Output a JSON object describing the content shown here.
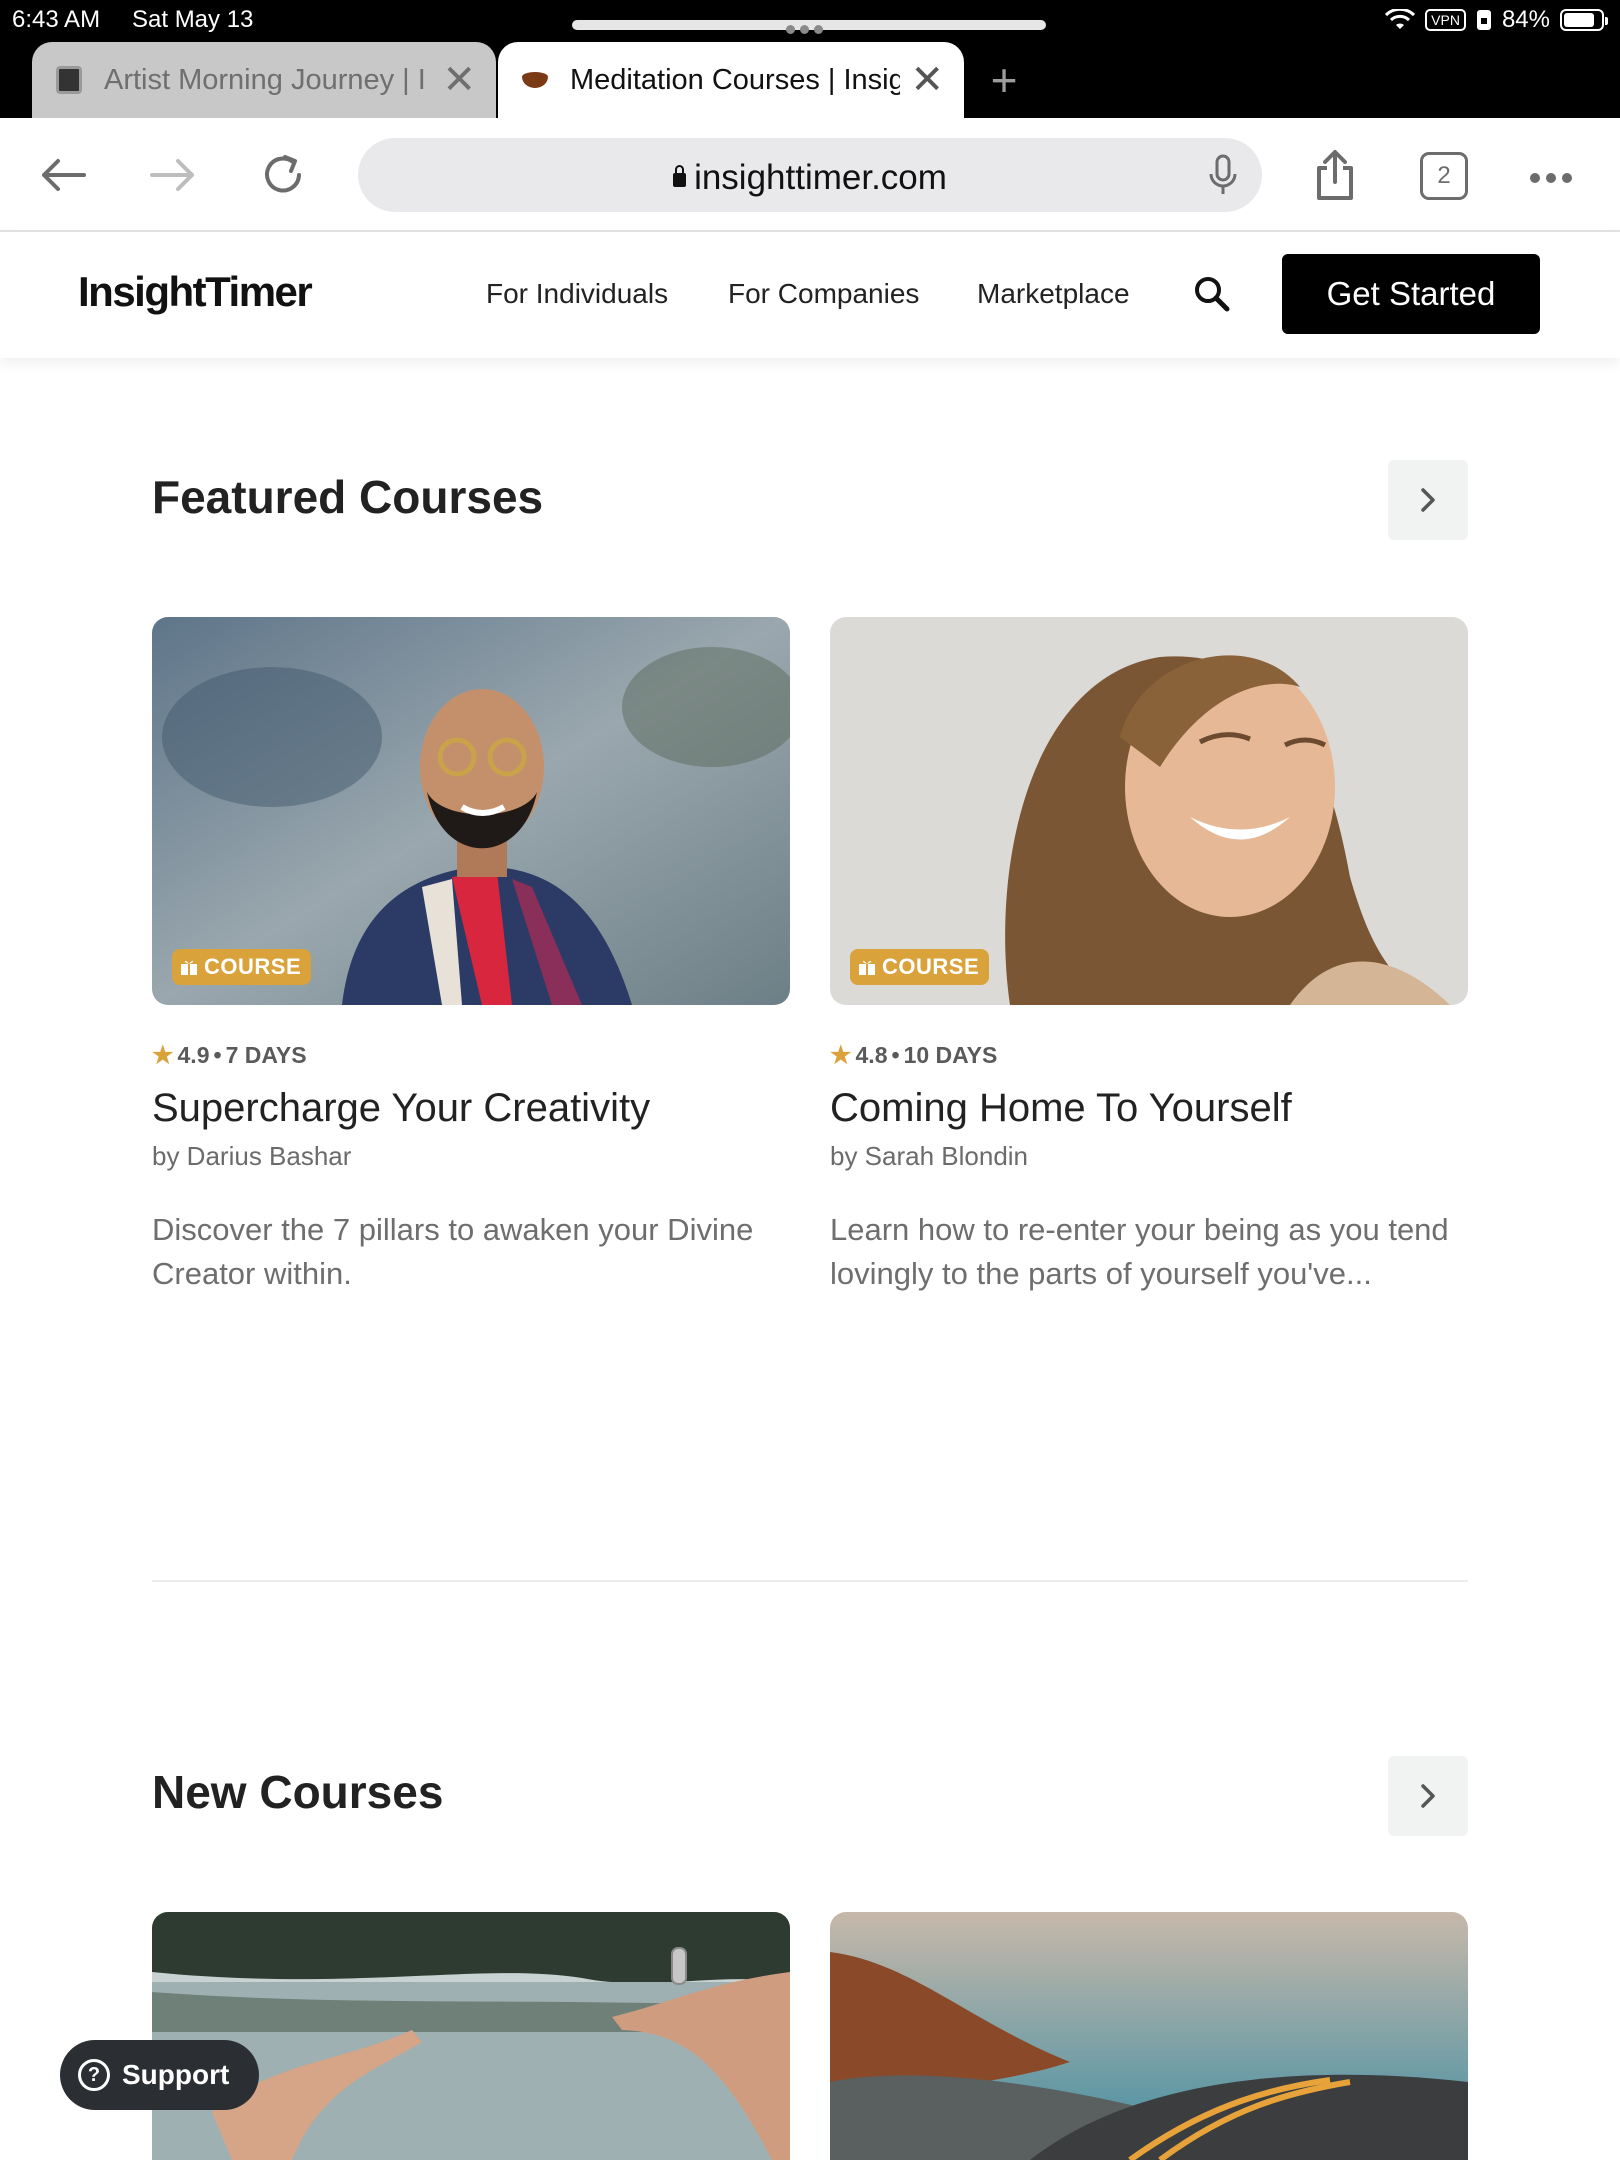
{
  "status_bar": {
    "time": "6:43 AM",
    "date": "Sat May 13",
    "vpn": "VPN",
    "battery": "84%",
    "battery_level": 0.84
  },
  "browser": {
    "tabs": [
      {
        "title": "Artist Morning Journey | I",
        "active": false
      },
      {
        "title": "Meditation Courses | Insig",
        "active": true
      }
    ],
    "url": "insighttimer.com",
    "tabs_count": "2"
  },
  "site_header": {
    "logo": "InsightTimer",
    "nav": [
      "For Individuals",
      "For Companies",
      "Marketplace"
    ],
    "cta": "Get Started"
  },
  "featured": {
    "title": "Featured Courses",
    "cards": [
      {
        "badge": "COURSE",
        "rating": "4.9",
        "duration": "7 DAYS",
        "title": "Supercharge Your Creativity",
        "author": "by Darius Bashar",
        "description": "Discover the 7 pillars to awaken your Divine Creator within."
      },
      {
        "badge": "COURSE",
        "rating": "4.8",
        "duration": "10 DAYS",
        "title": "Coming Home To Yourself",
        "author": "by Sarah Blondin",
        "description": "Learn how to re-enter your being as you tend lovingly to the parts of yourself you've..."
      }
    ]
  },
  "new_courses": {
    "title": "New Courses"
  },
  "support": {
    "label": "Support"
  },
  "colors": {
    "accent_gold": "#d9a23a",
    "cta_bg": "#000000",
    "support_bg": "#2b2f33"
  }
}
